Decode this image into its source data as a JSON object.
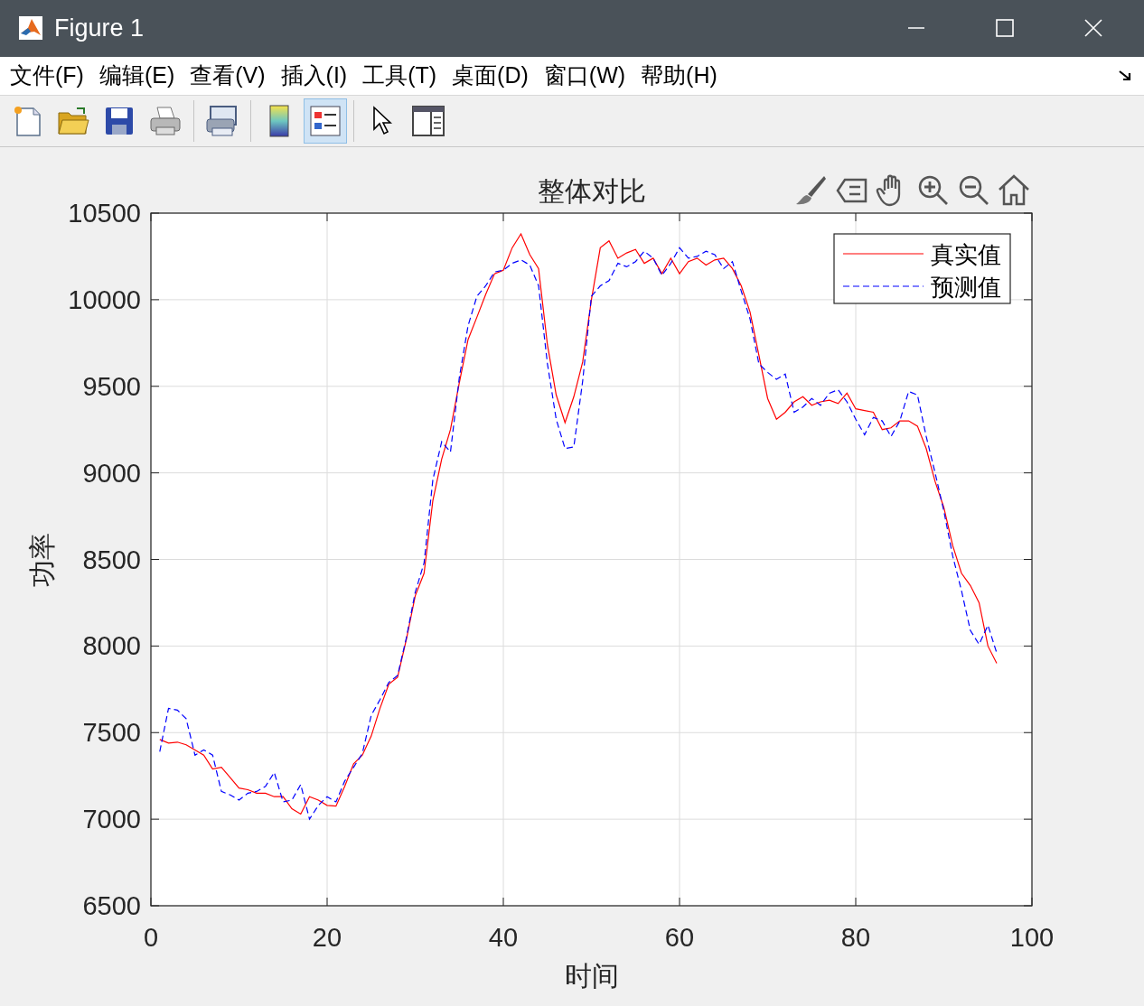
{
  "window": {
    "title": "Figure 1"
  },
  "menu": [
    "文件(F)",
    "编辑(E)",
    "查看(V)",
    "插入(I)",
    "工具(T)",
    "桌面(D)",
    "窗口(W)",
    "帮助(H)"
  ],
  "toolbar": {
    "groups": [
      {
        "buttons": [
          {
            "kind": "new",
            "selected": false
          },
          {
            "kind": "open",
            "selected": false
          },
          {
            "kind": "save",
            "selected": false
          },
          {
            "kind": "print",
            "selected": false
          }
        ]
      },
      {
        "buttons": [
          {
            "kind": "preview",
            "selected": false
          }
        ]
      },
      {
        "buttons": [
          {
            "kind": "colorbar",
            "selected": false
          },
          {
            "kind": "legend",
            "selected": true
          }
        ]
      },
      {
        "buttons": [
          {
            "kind": "pointer",
            "selected": false
          },
          {
            "kind": "property",
            "selected": false
          }
        ]
      }
    ]
  },
  "axes_toolbar": [
    {
      "kind": "brush"
    },
    {
      "kind": "datatip"
    },
    {
      "kind": "pan"
    },
    {
      "kind": "zoom_in"
    },
    {
      "kind": "zoom_out"
    },
    {
      "kind": "home"
    }
  ],
  "chart_data": {
    "type": "line",
    "title": "整体对比",
    "xlabel": "时间",
    "ylabel": "功率",
    "x": [
      1,
      2,
      3,
      4,
      5,
      6,
      7,
      8,
      9,
      10,
      11,
      12,
      13,
      14,
      15,
      16,
      17,
      18,
      19,
      20,
      21,
      22,
      23,
      24,
      25,
      26,
      27,
      28,
      29,
      30,
      31,
      32,
      33,
      34,
      35,
      36,
      37,
      38,
      39,
      40,
      41,
      42,
      43,
      44,
      45,
      46,
      47,
      48,
      49,
      50,
      51,
      52,
      53,
      54,
      55,
      56,
      57,
      58,
      59,
      60,
      61,
      62,
      63,
      64,
      65,
      66,
      67,
      68,
      69,
      70,
      71,
      72,
      73,
      74,
      75,
      76,
      77,
      78,
      79,
      80,
      81,
      82,
      83,
      84,
      85,
      86,
      87,
      88,
      89,
      90,
      91,
      92,
      93,
      94,
      95,
      96
    ],
    "series": [
      {
        "name": "真实值",
        "color": "#ff0000",
        "line_style": "solid",
        "values": [
          7460,
          7440,
          7445,
          7430,
          7400,
          7370,
          7290,
          7300,
          7240,
          7180,
          7170,
          7150,
          7150,
          7130,
          7130,
          7060,
          7030,
          7130,
          7110,
          7080,
          7075,
          7190,
          7320,
          7370,
          7480,
          7640,
          7780,
          7820,
          8040,
          8290,
          8420,
          8840,
          9080,
          9250,
          9520,
          9770,
          9900,
          10030,
          10150,
          10170,
          10300,
          10380,
          10260,
          10180,
          9740,
          9450,
          9290,
          9440,
          9640,
          10000,
          10300,
          10340,
          10240,
          10270,
          10290,
          10210,
          10240,
          10150,
          10240,
          10150,
          10220,
          10240,
          10200,
          10230,
          10240,
          10180,
          10080,
          9930,
          9680,
          9430,
          9310,
          9350,
          9410,
          9440,
          9390,
          9410,
          9420,
          9400,
          9460,
          9370,
          9360,
          9350,
          9250,
          9260,
          9300,
          9300,
          9270,
          9140,
          8950,
          8800,
          8580,
          8420,
          8350,
          8250,
          8000,
          7900
        ]
      },
      {
        "name": "预测值",
        "color": "#0000ff",
        "line_style": "dashed",
        "values": [
          7390,
          7640,
          7630,
          7580,
          7370,
          7400,
          7370,
          7160,
          7140,
          7110,
          7150,
          7160,
          7190,
          7270,
          7100,
          7110,
          7200,
          7000,
          7080,
          7130,
          7100,
          7220,
          7300,
          7380,
          7600,
          7690,
          7790,
          7830,
          8050,
          8310,
          8480,
          8960,
          9180,
          9120,
          9550,
          9850,
          10020,
          10080,
          10160,
          10170,
          10210,
          10230,
          10200,
          10080,
          9630,
          9310,
          9140,
          9150,
          9530,
          10020,
          10080,
          10110,
          10210,
          10190,
          10220,
          10280,
          10240,
          10140,
          10210,
          10300,
          10240,
          10250,
          10280,
          10260,
          10180,
          10220,
          10050,
          9890,
          9630,
          9580,
          9540,
          9570,
          9350,
          9380,
          9430,
          9390,
          9460,
          9480,
          9410,
          9310,
          9220,
          9320,
          9300,
          9210,
          9300,
          9470,
          9450,
          9210,
          9000,
          8780,
          8520,
          8320,
          8090,
          8010,
          8120,
          7960
        ]
      }
    ],
    "xlim": [
      0,
      100
    ],
    "ylim": [
      6500,
      10500
    ],
    "grid": true,
    "legend": true,
    "xticks": [
      0,
      20,
      40,
      60,
      80,
      100
    ],
    "yticks": [
      6500,
      7000,
      7500,
      8000,
      8500,
      9000,
      9500,
      10000,
      10500
    ]
  }
}
